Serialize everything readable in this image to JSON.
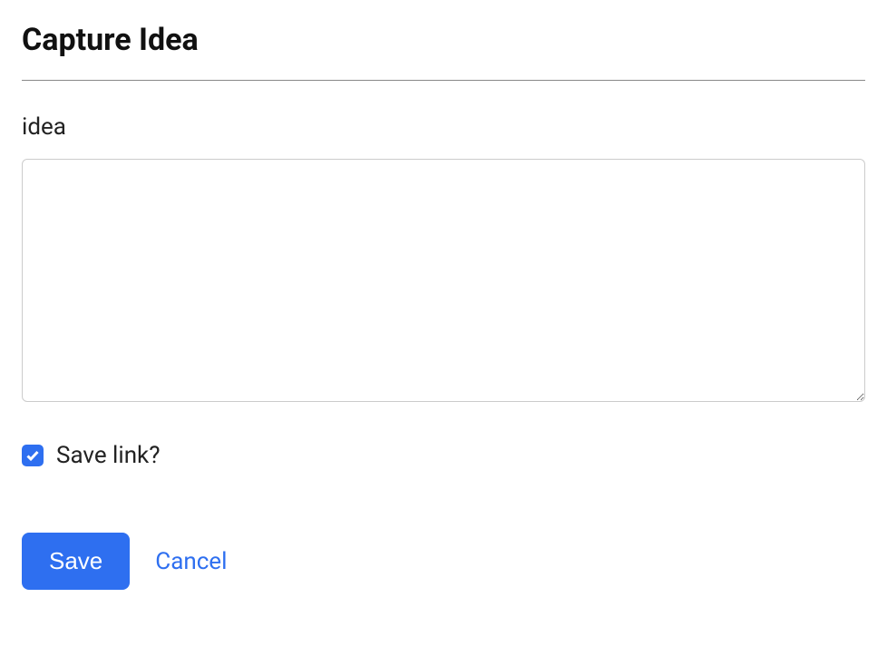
{
  "header": {
    "title": "Capture Idea"
  },
  "form": {
    "idea": {
      "label": "idea",
      "value": ""
    },
    "save_link": {
      "label": "Save link?",
      "checked": true
    },
    "actions": {
      "save_label": "Save",
      "cancel_label": "Cancel"
    }
  }
}
